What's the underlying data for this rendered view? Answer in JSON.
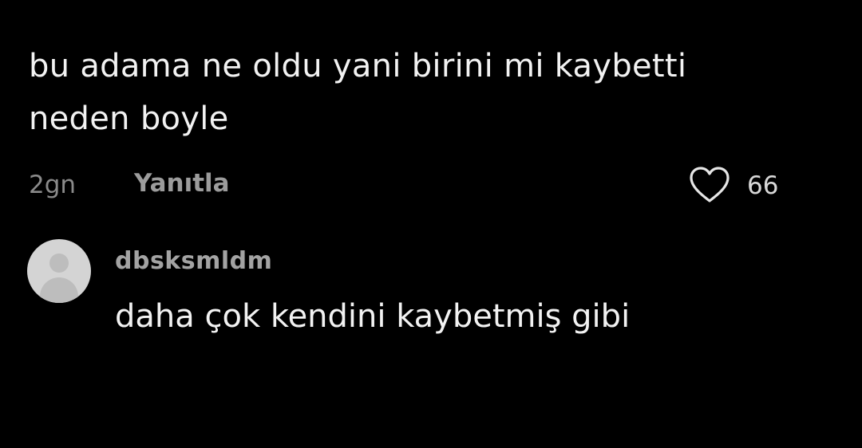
{
  "comment": {
    "lines": [
      "bu adama ne oldu yani birini mi kaybetti",
      "neden boyle"
    ],
    "timestamp": "2gn",
    "reply_label": "Yanıtla",
    "like_count": "66",
    "like_icon": "heart-outline-icon"
  },
  "reply": {
    "username": "dbsksmldm",
    "text": "daha çok kendini kaybetmiş gibi",
    "avatar_icon": "default-avatar-icon"
  },
  "colors": {
    "background": "#000000",
    "primary_text": "#f2f2f2",
    "secondary_text": "#8a8a8a"
  }
}
